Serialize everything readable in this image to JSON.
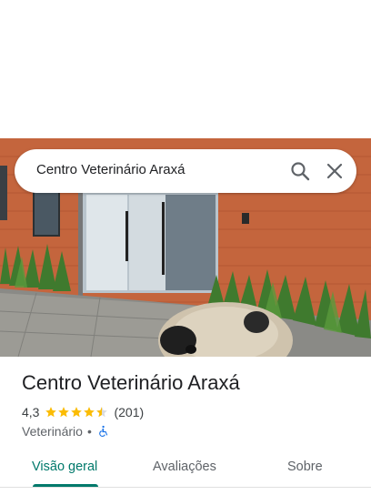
{
  "search": {
    "query": "Centro Veterinário Araxá"
  },
  "place": {
    "title": "Centro Veterinário Araxá",
    "rating": "4,3",
    "rating_value": 4.3,
    "reviews": "(201)",
    "category": "Veterinário",
    "separator": "•"
  },
  "tabs": [
    {
      "label": "Visão geral"
    },
    {
      "label": "Avaliações"
    },
    {
      "label": "Sobre"
    }
  ],
  "colors": {
    "accent": "#00796b",
    "star": "#fbbc04",
    "accessible": "#1a73e8"
  },
  "icons": {
    "search": "search-icon",
    "close": "close-icon",
    "accessible": "wheelchair-icon"
  }
}
